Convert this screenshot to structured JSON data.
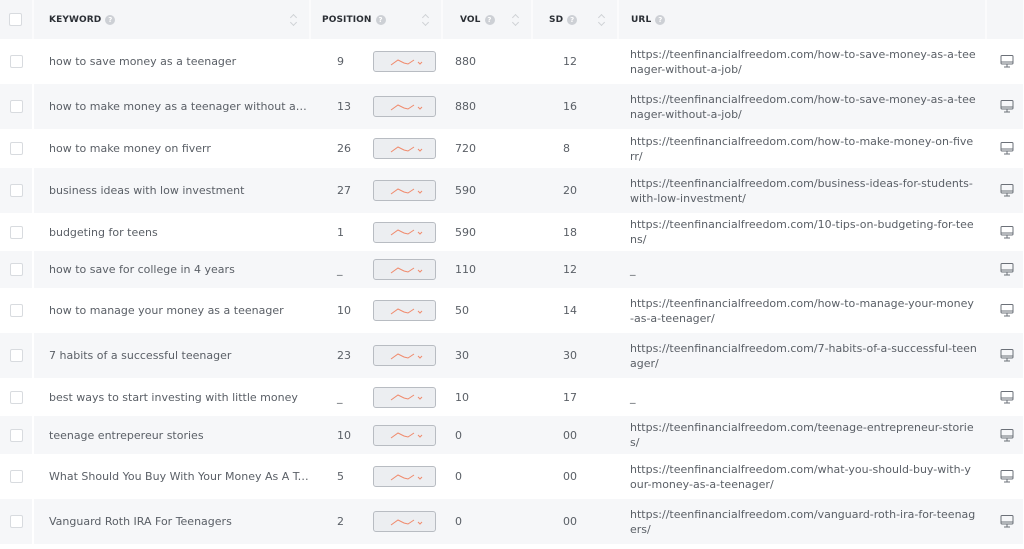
{
  "header": {
    "keyword": "KEYWORD",
    "position": "POSITION",
    "vol": "VOL",
    "sd": "SD",
    "url": "URL",
    "help_glyph": "?"
  },
  "colors": {
    "trend_line": "#f08a6c",
    "header_bg": "#f5f6f8",
    "row_alt_bg": "#f6f7f9"
  },
  "rows": [
    {
      "keyword": "how to save money as a teenager",
      "position": "9",
      "vol": "880",
      "sd": "12",
      "url": "https://teenfinancialfreedom.com/how-to-save-money-as-a-teenager-without-a-job/"
    },
    {
      "keyword": "how to make money as a teenager without a j...",
      "position": "13",
      "vol": "880",
      "sd": "16",
      "url": "https://teenfinancialfreedom.com/how-to-save-money-as-a-teenager-without-a-job/"
    },
    {
      "keyword": "how to make money on fiverr",
      "position": "26",
      "vol": "720",
      "sd": "8",
      "url": "https://teenfinancialfreedom.com/how-to-make-money-on-fiverr/"
    },
    {
      "keyword": "business ideas with low investment",
      "position": "27",
      "vol": "590",
      "sd": "20",
      "url": "https://teenfinancialfreedom.com/business-ideas-for-students-with-low-investment/"
    },
    {
      "keyword": "budgeting for teens",
      "position": "1",
      "vol": "590",
      "sd": "18",
      "url": "https://teenfinancialfreedom.com/10-tips-on-budgeting-for-teens/"
    },
    {
      "keyword": "how to save for college in 4 years",
      "position": "_",
      "vol": "110",
      "sd": "12",
      "url": "_"
    },
    {
      "keyword": "how to manage your money as a teenager",
      "position": "10",
      "vol": "50",
      "sd": "14",
      "url": "https://teenfinancialfreedom.com/how-to-manage-your-money-as-a-teenager/"
    },
    {
      "keyword": "7 habits of a successful teenager",
      "position": "23",
      "vol": "30",
      "sd": "30",
      "url": "https://teenfinancialfreedom.com/7-habits-of-a-successful-teenager/"
    },
    {
      "keyword": "best ways to start investing with little money",
      "position": "_",
      "vol": "10",
      "sd": "17",
      "url": "_"
    },
    {
      "keyword": "teenage entrepereur stories",
      "position": "10",
      "vol": "0",
      "sd": "00",
      "url": "https://teenfinancialfreedom.com/teenage-entrepreneur-stories/"
    },
    {
      "keyword": "What Should You Buy With Your Money As A Te...",
      "position": "5",
      "vol": "0",
      "sd": "00",
      "url": "https://teenfinancialfreedom.com/what-you-should-buy-with-your-money-as-a-teenager/"
    },
    {
      "keyword": "Vanguard Roth IRA For Teenagers",
      "position": "2",
      "vol": "0",
      "sd": "00",
      "url": "https://teenfinancialfreedom.com/vanguard-roth-ira-for-teenagers/"
    }
  ]
}
